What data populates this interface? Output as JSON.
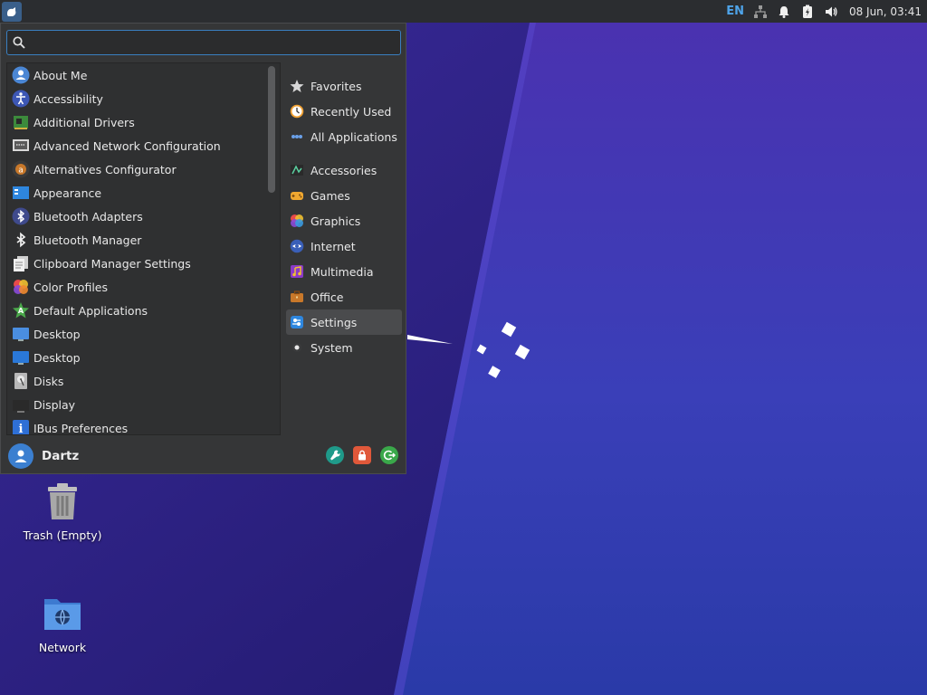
{
  "panel": {
    "lang": "EN",
    "clock": "08 Jun, 03:41"
  },
  "menu": {
    "search": {
      "value": "",
      "placeholder": ""
    },
    "apps": [
      {
        "label": "About Me",
        "icon": "user-icon"
      },
      {
        "label": "Accessibility",
        "icon": "accessibility-icon"
      },
      {
        "label": "Additional Drivers",
        "icon": "chip-icon"
      },
      {
        "label": "Advanced Network Configuration",
        "icon": "network-config-icon"
      },
      {
        "label": "Alternatives Configurator",
        "icon": "alternatives-icon"
      },
      {
        "label": "Appearance",
        "icon": "appearance-icon"
      },
      {
        "label": "Bluetooth Adapters",
        "icon": "bluetooth-icon"
      },
      {
        "label": "Bluetooth Manager",
        "icon": "bluetooth-icon"
      },
      {
        "label": "Clipboard Manager Settings",
        "icon": "clipboard-icon"
      },
      {
        "label": "Color Profiles",
        "icon": "color-icon"
      },
      {
        "label": "Default Applications",
        "icon": "default-apps-icon"
      },
      {
        "label": "Desktop",
        "icon": "desktop-icon"
      },
      {
        "label": "Desktop",
        "icon": "desktop-icon"
      },
      {
        "label": "Disks",
        "icon": "disks-icon"
      },
      {
        "label": "Display",
        "icon": "display-icon"
      },
      {
        "label": "IBus Preferences",
        "icon": "info-icon"
      }
    ],
    "categories_top": [
      {
        "label": "Favorites",
        "icon": "star-icon"
      },
      {
        "label": "Recently Used",
        "icon": "clock-icon"
      },
      {
        "label": "All Applications",
        "icon": "grid-icon"
      }
    ],
    "categories": [
      {
        "label": "Accessories",
        "icon": "accessories-icon"
      },
      {
        "label": "Games",
        "icon": "gamepad-icon"
      },
      {
        "label": "Graphics",
        "icon": "graphics-icon"
      },
      {
        "label": "Internet",
        "icon": "globe-icon"
      },
      {
        "label": "Multimedia",
        "icon": "multimedia-icon"
      },
      {
        "label": "Office",
        "icon": "briefcase-icon"
      },
      {
        "label": "Settings",
        "icon": "settings-icon",
        "selected": true
      },
      {
        "label": "System",
        "icon": "system-icon"
      }
    ],
    "user": {
      "name": "Dartz"
    }
  },
  "desktop": {
    "icons": [
      {
        "label": "Trash (Empty)",
        "icon": "trash-icon"
      },
      {
        "label": "Network",
        "icon": "network-folder-icon"
      }
    ]
  },
  "colors": {
    "accent": "#3a7fc0",
    "panel": "#2b2d30",
    "menu_bg": "#353637",
    "desktop_bg": "#2a1f7a"
  }
}
